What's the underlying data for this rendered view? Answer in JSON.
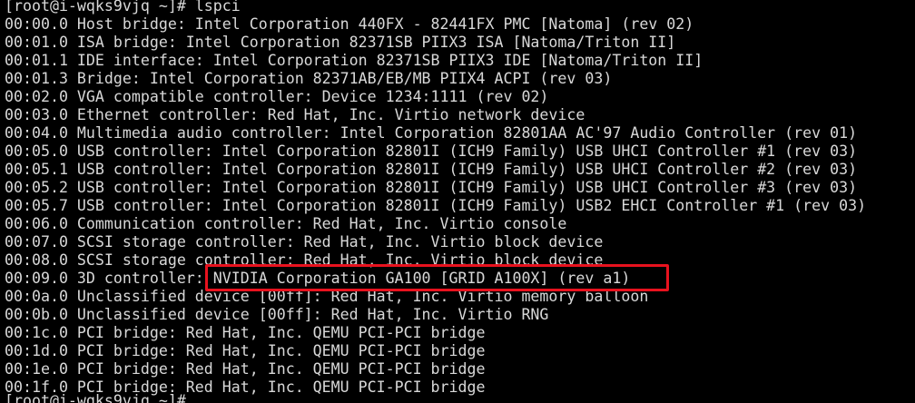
{
  "terminal": {
    "prompt": "[root@i-wqks9vjq ~]# lspci",
    "lines": [
      "00:00.0 Host bridge: Intel Corporation 440FX - 82441FX PMC [Natoma] (rev 02)",
      "00:01.0 ISA bridge: Intel Corporation 82371SB PIIX3 ISA [Natoma/Triton II]",
      "00:01.1 IDE interface: Intel Corporation 82371SB PIIX3 IDE [Natoma/Triton II]",
      "00:01.3 Bridge: Intel Corporation 82371AB/EB/MB PIIX4 ACPI (rev 03)",
      "00:02.0 VGA compatible controller: Device 1234:1111 (rev 02)",
      "00:03.0 Ethernet controller: Red Hat, Inc. Virtio network device",
      "00:04.0 Multimedia audio controller: Intel Corporation 82801AA AC'97 Audio Controller (rev 01)",
      "00:05.0 USB controller: Intel Corporation 82801I (ICH9 Family) USB UHCI Controller #1 (rev 03)",
      "00:05.1 USB controller: Intel Corporation 82801I (ICH9 Family) USB UHCI Controller #2 (rev 03)",
      "00:05.2 USB controller: Intel Corporation 82801I (ICH9 Family) USB UHCI Controller #3 (rev 03)",
      "00:05.7 USB controller: Intel Corporation 82801I (ICH9 Family) USB2 EHCI Controller #1 (rev 03)",
      "00:06.0 Communication controller: Red Hat, Inc. Virtio console",
      "00:07.0 SCSI storage controller: Red Hat, Inc. Virtio block device",
      "00:08.0 SCSI storage controller: Red Hat, Inc. Virtio block device",
      "00:09.0 3D controller: NVIDIA Corporation GA100 [GRID A100X] (rev a1)",
      "00:0a.0 Unclassified device [00ff]: Red Hat, Inc. Virtio memory balloon",
      "00:0b.0 Unclassified device [00ff]: Red Hat, Inc. Virtio RNG",
      "00:1c.0 PCI bridge: Red Hat, Inc. QEMU PCI-PCI bridge",
      "00:1d.0 PCI bridge: Red Hat, Inc. QEMU PCI-PCI bridge",
      "00:1e.0 PCI bridge: Red Hat, Inc. QEMU PCI-PCI bridge",
      "00:1f.0 PCI bridge: Red Hat, Inc. QEMU PCI-PCI bridge"
    ],
    "next_prompt_partial": "[root@i-wqks9vjq ~]#",
    "text_color": "#d8d8d8",
    "background_color": "#000000"
  },
  "annotation": {
    "highlight_color": "#e8121e"
  }
}
